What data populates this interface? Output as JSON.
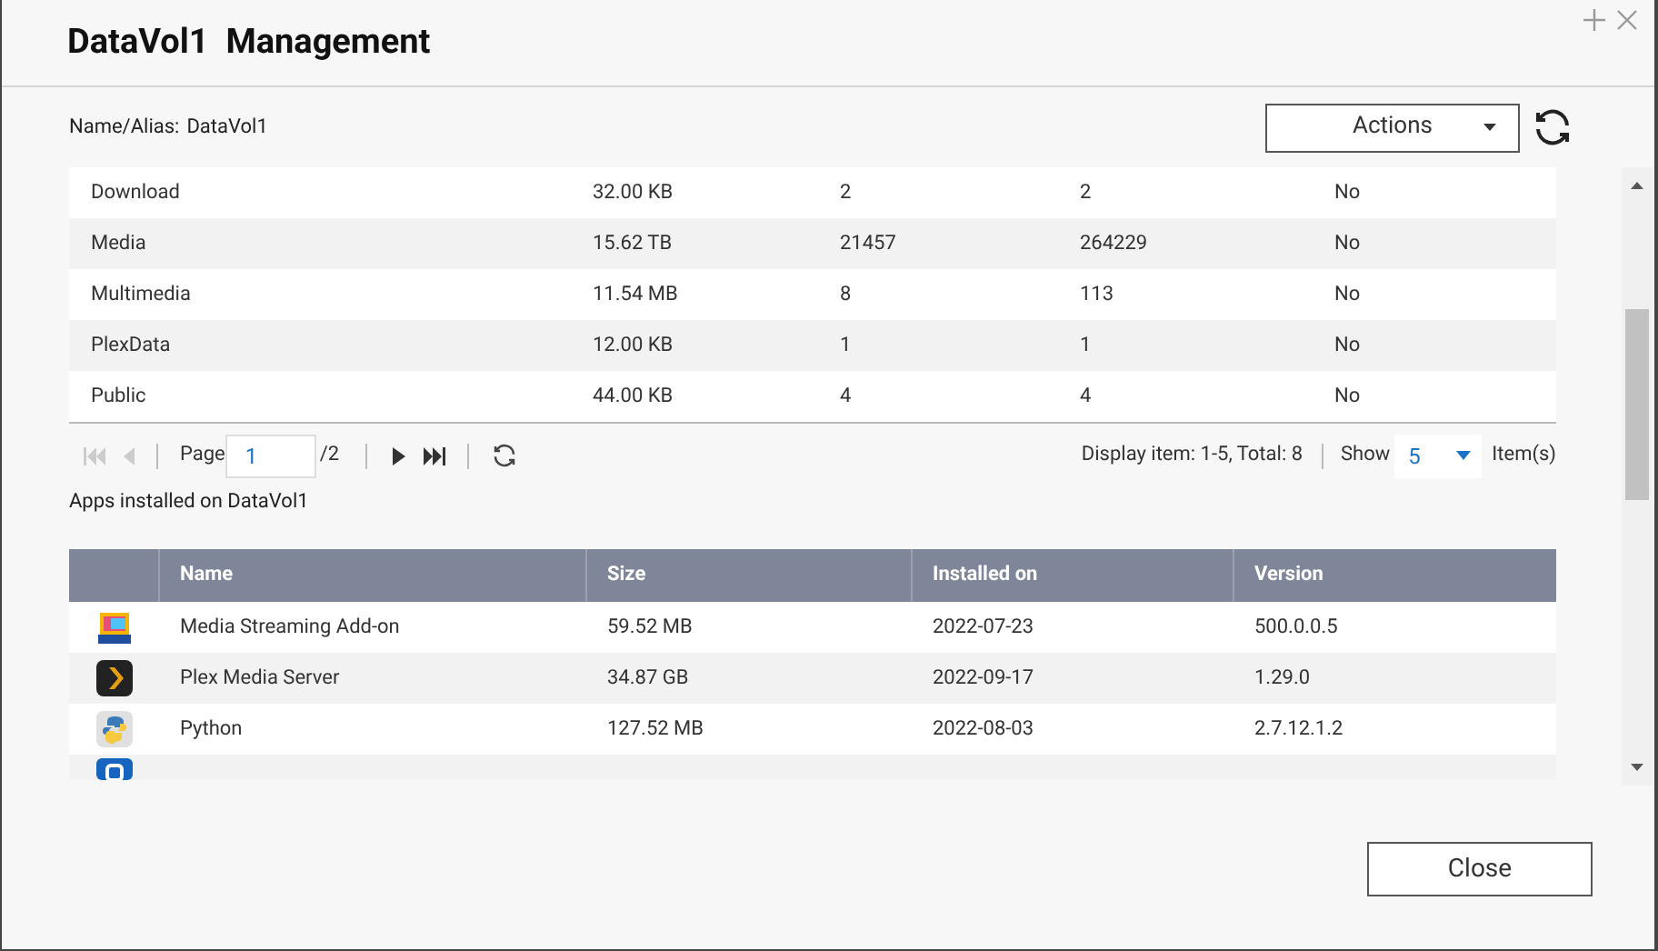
{
  "window": {
    "title": "DataVol1  Management"
  },
  "name_alias": {
    "label": "Name/Alias:",
    "value": "DataVol1"
  },
  "actions": {
    "label": "Actions"
  },
  "folders": [
    {
      "name": "Download",
      "size": "32.00 KB",
      "column_3": "2",
      "column_4": "2",
      "column_5": "No"
    },
    {
      "name": "Media",
      "size": "15.62 TB",
      "column_3": "21457",
      "column_4": "264229",
      "column_5": "No"
    },
    {
      "name": "Multimedia",
      "size": "11.54 MB",
      "column_3": "8",
      "column_4": "113",
      "column_5": "No"
    },
    {
      "name": "PlexData",
      "size": "12.00 KB",
      "column_3": "1",
      "column_4": "1",
      "column_5": "No"
    },
    {
      "name": "Public",
      "size": "44.00 KB",
      "column_3": "4",
      "column_4": "4",
      "column_5": "No"
    }
  ],
  "pager": {
    "page_label": "Page",
    "page": "1",
    "of": "/2",
    "display": "Display item: 1-5, Total: 8",
    "show_label": "Show",
    "show": "5",
    "items_label": "Item(s)"
  },
  "apps_title": "Apps installed on DataVol1",
  "apps": {
    "columns": [
      "Name",
      "Size",
      "Installed on",
      "Version"
    ],
    "rows": [
      {
        "kind": "media",
        "name": "Media Streaming Add-on",
        "size": "59.52 MB",
        "installed": "2022-07-23",
        "version": "500.0.0.5"
      },
      {
        "kind": "plex",
        "name": "Plex Media Server",
        "size": "34.87 GB",
        "installed": "2022-09-17",
        "version": "1.29.0"
      },
      {
        "kind": "python",
        "name": "Python",
        "size": "127.52 MB",
        "installed": "2022-08-03",
        "version": "2.7.12.1.2"
      },
      {
        "kind": "cloud"
      }
    ]
  },
  "close": "Close"
}
